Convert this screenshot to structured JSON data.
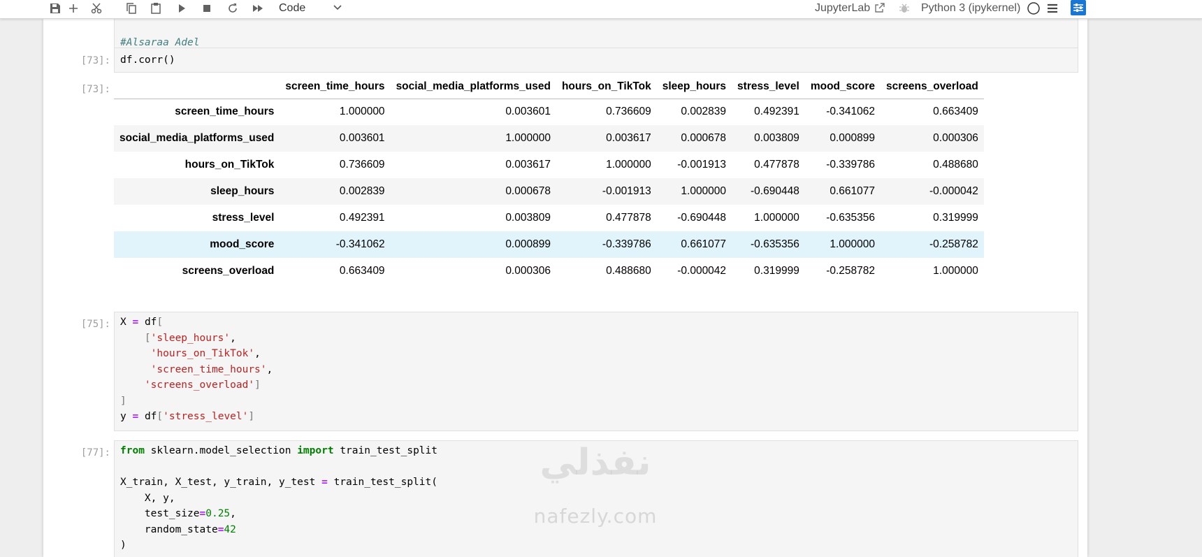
{
  "toolbar": {
    "cell_type": "Code",
    "jupyterlab_label": "JupyterLab",
    "kernel_label": "Python 3 (ipykernel)",
    "icons": [
      "save-icon",
      "add-icon",
      "cut-icon",
      "copy-icon",
      "paste-icon",
      "run-icon",
      "stop-icon",
      "restart-icon",
      "fast-forward-icon"
    ]
  },
  "cells": {
    "c0": {
      "comment": "#Alsaraa Adel"
    },
    "c1": {
      "prompt": "[73]:",
      "code": "df.corr()",
      "out_prompt": "[73]:"
    },
    "c2": {
      "prompt": "[75]:",
      "l1a": "X",
      "l1b": "=",
      "l1c": "df",
      "l1d": "[",
      "l2": "'sleep_hours'",
      "l3": "'hours_on_TikTok'",
      "l4": "'screen_time_hours'",
      "l5": "'screens_overload'",
      "l6": "]",
      "l7a": "y",
      "l7b": "=",
      "l7c": "df",
      "l7d": "[",
      "l7e": "'stress_level'",
      "l7f": "]"
    },
    "c3": {
      "prompt": "[77]:",
      "from": "from",
      "module": "sklearn.model_selection",
      "import": "import",
      "name": "train_test_split",
      "l3a": "X_train, X_test, y_train, y_test",
      "l3b": "=",
      "l3c": "train_test_split(",
      "l4": "X, y,",
      "l5a": "test_size",
      "l5b": "=",
      "l5c": "0.25",
      "l6a": "random_state",
      "l6b": "=",
      "l6c": "42",
      "l7": ")"
    }
  },
  "dataframe": {
    "columns": [
      "screen_time_hours",
      "social_media_platforms_used",
      "hours_on_TikTok",
      "sleep_hours",
      "stress_level",
      "mood_score",
      "screens_overload"
    ],
    "rows": [
      {
        "index": "screen_time_hours",
        "values": [
          "1.000000",
          "0.003601",
          "0.736609",
          "0.002839",
          "0.492391",
          "-0.341062",
          "0.663409"
        ]
      },
      {
        "index": "social_media_platforms_used",
        "values": [
          "0.003601",
          "1.000000",
          "0.003617",
          "0.000678",
          "0.003809",
          "0.000899",
          "0.000306"
        ]
      },
      {
        "index": "hours_on_TikTok",
        "values": [
          "0.736609",
          "0.003617",
          "1.000000",
          "-0.001913",
          "0.477878",
          "-0.339786",
          "0.488680"
        ]
      },
      {
        "index": "sleep_hours",
        "values": [
          "0.002839",
          "0.000678",
          "-0.001913",
          "1.000000",
          "-0.690448",
          "0.661077",
          "-0.000042"
        ]
      },
      {
        "index": "stress_level",
        "values": [
          "0.492391",
          "0.003809",
          "0.477878",
          "-0.690448",
          "1.000000",
          "-0.635356",
          "0.319999"
        ]
      },
      {
        "index": "mood_score",
        "values": [
          "-0.341062",
          "0.000899",
          "-0.339786",
          "0.661077",
          "-0.635356",
          "1.000000",
          "-0.258782"
        ]
      },
      {
        "index": "screens_overload",
        "values": [
          "0.663409",
          "0.000306",
          "0.488680",
          "-0.000042",
          "0.319999",
          "-0.258782",
          "1.000000"
        ]
      }
    ]
  },
  "watermark": {
    "arabic": "نفذلي",
    "latin": "nafezly.com"
  }
}
